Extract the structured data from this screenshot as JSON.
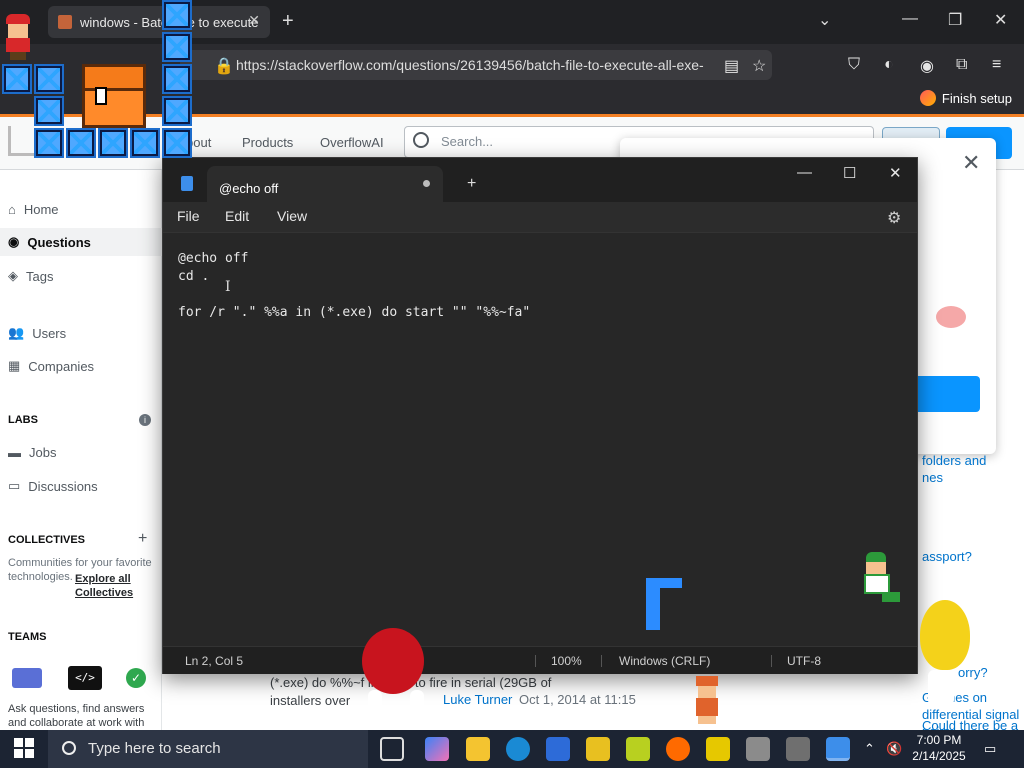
{
  "browser": {
    "tab_title": "windows - Batch file to execute",
    "tab_close": "✕",
    "new_tab": "+",
    "window_minimize": "—",
    "window_restore": "❐",
    "window_close": "✕",
    "tab_list": "⌄",
    "url": "https://stackoverflow.com/questions/26139456/batch-file-to-execute-all-exe-",
    "finish_setup": "Finish setup"
  },
  "so": {
    "nav_about": "bout",
    "nav_products": "Products",
    "nav_overflowai": "OverflowAI",
    "search_placeholder": "Search...",
    "left_nav": {
      "home": "Home",
      "questions": "Questions",
      "tags": "Tags",
      "users": "Users",
      "companies": "Companies",
      "labs": "LABS",
      "jobs": "Jobs",
      "discussions": "Discussions",
      "collectives": "COLLECTIVES",
      "collectives_text": "Communities for your favorite technologies.",
      "explore_all": "Explore all Collectives",
      "teams": "TEAMS",
      "teams_text": "Ask questions, find answers and collaborate at work with"
    },
    "right": {
      "link1": "folders and",
      "link1b": "nes",
      "link2": "assport?",
      "link3": "orry?",
      "link4": "Glitches on differential signal pairs",
      "link5": "Could there be a perfect chess strategy? What"
    },
    "modal_close": "✕",
    "bottom": {
      "question_line1": "(*.exe) do %%~f   like this to fire in serial (29GB of",
      "question_line2": "installers over",
      "user": "Luke Turner",
      "date": "Oct 1, 2014 at 11:15"
    }
  },
  "notepad": {
    "tab_title": "@echo off",
    "new_tab": "+",
    "minimize": "—",
    "maximize": "☐",
    "close": "✕",
    "menu": {
      "file": "File",
      "edit": "Edit",
      "view": "View"
    },
    "settings_icon": "⚙",
    "lines": [
      "@echo off",
      "cd .",
      "",
      "for /r \".\" %%a in (*.exe) do start \"\" \"%%~fa\""
    ],
    "status": {
      "position": "Ln 2, Col 5",
      "zoom": "100%",
      "line_ending": "Windows (CRLF)",
      "encoding": "UTF-8"
    }
  },
  "taskbar": {
    "search_placeholder": "Type here to search",
    "time": "7:00 PM",
    "date": "2/14/2025"
  }
}
